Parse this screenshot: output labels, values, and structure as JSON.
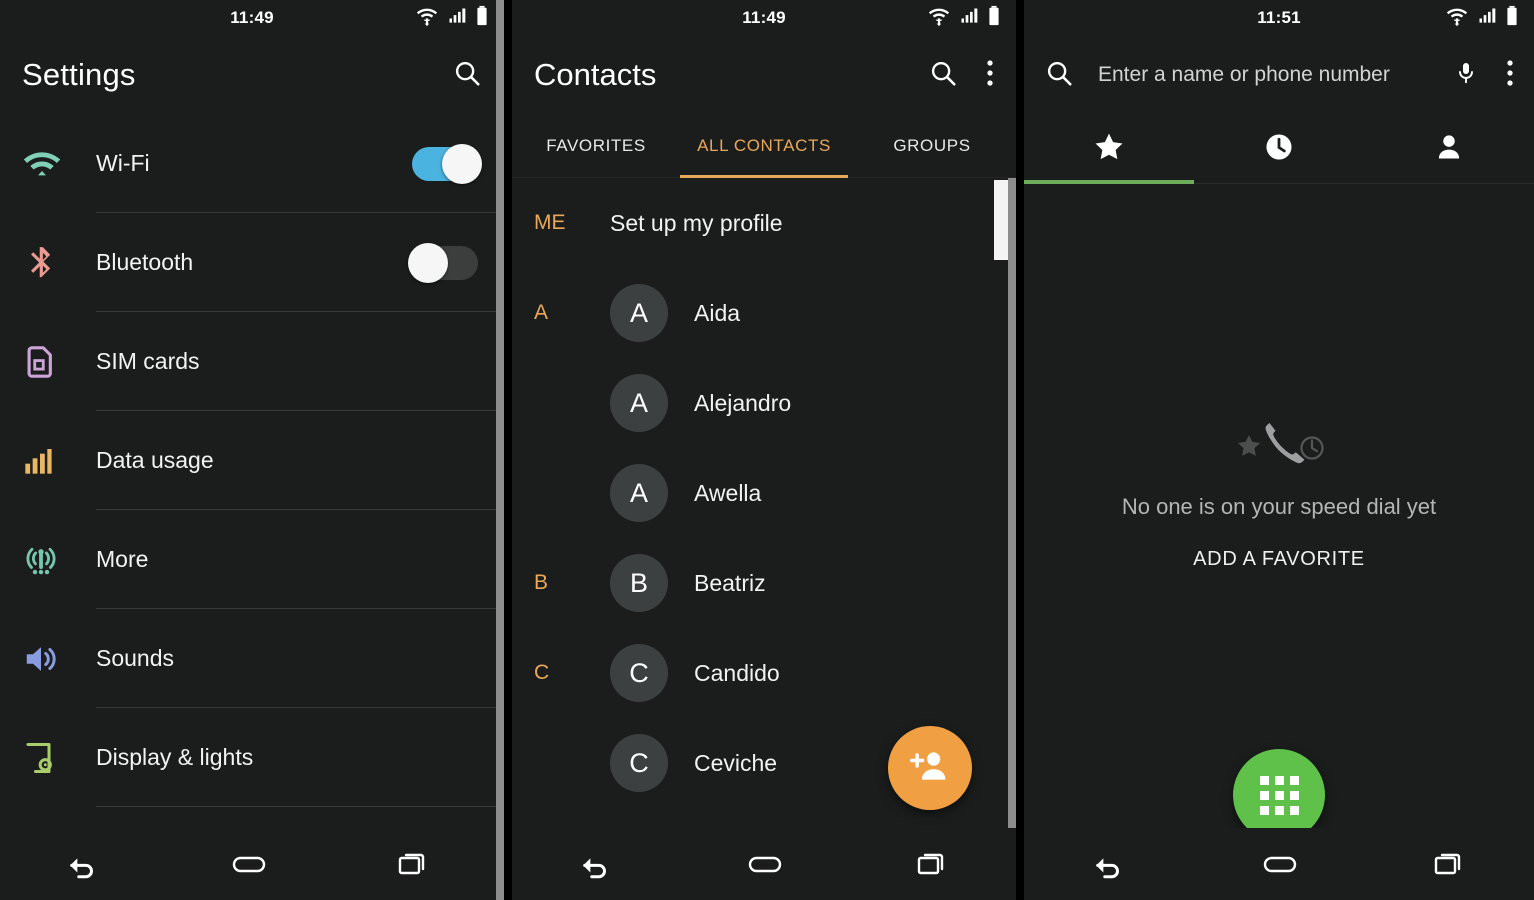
{
  "panels": {
    "settings": {
      "status": {
        "time": "11:49",
        "wifi": "wifi-icon",
        "signal": "signal-icon",
        "battery": "battery-icon"
      },
      "appbar": {
        "title": "Settings",
        "search": "search-icon"
      },
      "items": [
        {
          "label": "Wi-Fi",
          "icon": "wifi-icon",
          "icon_color": "#7fd0b6",
          "control": "toggle",
          "state": "on"
        },
        {
          "label": "Bluetooth",
          "icon": "bluetooth-icon",
          "icon_color": "#e79b92",
          "control": "toggle",
          "state": "off"
        },
        {
          "label": "SIM cards",
          "icon": "sim-card-icon",
          "icon_color": "#cda4d8",
          "control": "none",
          "state": ""
        },
        {
          "label": "Data usage",
          "icon": "bar-chart-icon",
          "icon_color": "#e8b765",
          "control": "none",
          "state": ""
        },
        {
          "label": "More",
          "icon": "broadcast-icon",
          "icon_color": "#76c5ad",
          "control": "none",
          "state": ""
        },
        {
          "label": "Sounds",
          "icon": "volume-icon",
          "icon_color": "#8a9ce0",
          "control": "none",
          "state": ""
        },
        {
          "label": "Display & lights",
          "icon": "display-icon",
          "icon_color": "#a9cd6a",
          "control": "none",
          "state": ""
        }
      ],
      "navbar": {
        "back": "back-icon",
        "home": "home-icon",
        "recents": "recents-icon"
      }
    },
    "contacts": {
      "status": {
        "time": "11:49"
      },
      "appbar": {
        "title": "Contacts",
        "search": "search-icon",
        "overflow": "more-vertical-icon"
      },
      "tabs": [
        {
          "label": "FAVORITES",
          "active": false
        },
        {
          "label": "ALL CONTACTS",
          "active": true
        },
        {
          "label": "GROUPS",
          "active": false
        }
      ],
      "me": {
        "section": "ME",
        "label": "Set up my profile"
      },
      "rows": [
        {
          "section": "A",
          "initial": "A",
          "name": "Aida"
        },
        {
          "section": "",
          "initial": "A",
          "name": "Alejandro"
        },
        {
          "section": "",
          "initial": "A",
          "name": "Awella"
        },
        {
          "section": "B",
          "initial": "B",
          "name": "Beatriz"
        },
        {
          "section": "C",
          "initial": "C",
          "name": "Candido"
        },
        {
          "section": "",
          "initial": "C",
          "name": "Ceviche"
        }
      ],
      "fab": {
        "icon": "add-contact-icon",
        "color": "#f0a042"
      },
      "navbar": {
        "back": "back-icon",
        "home": "home-icon",
        "recents": "recents-icon"
      }
    },
    "dialer": {
      "status": {
        "time": "11:51"
      },
      "search": {
        "icon": "search-icon",
        "placeholder": "Enter a name or phone number",
        "value": "",
        "voice": "microphone-icon",
        "overflow": "more-vertical-icon"
      },
      "tabs": [
        {
          "icon": "star-icon",
          "active": true
        },
        {
          "icon": "clock-icon",
          "active": false
        },
        {
          "icon": "person-icon",
          "active": false
        }
      ],
      "tab_indicator_color": "#6dad5a",
      "empty": {
        "icon": "speed-dial-icon",
        "message": "No one is on your speed dial yet",
        "action": "ADD A FAVORITE"
      },
      "fab": {
        "icon": "dialpad-icon",
        "color": "#5fc04a"
      },
      "navbar": {
        "back": "back-icon",
        "home": "home-icon",
        "recents": "recents-icon"
      }
    }
  }
}
